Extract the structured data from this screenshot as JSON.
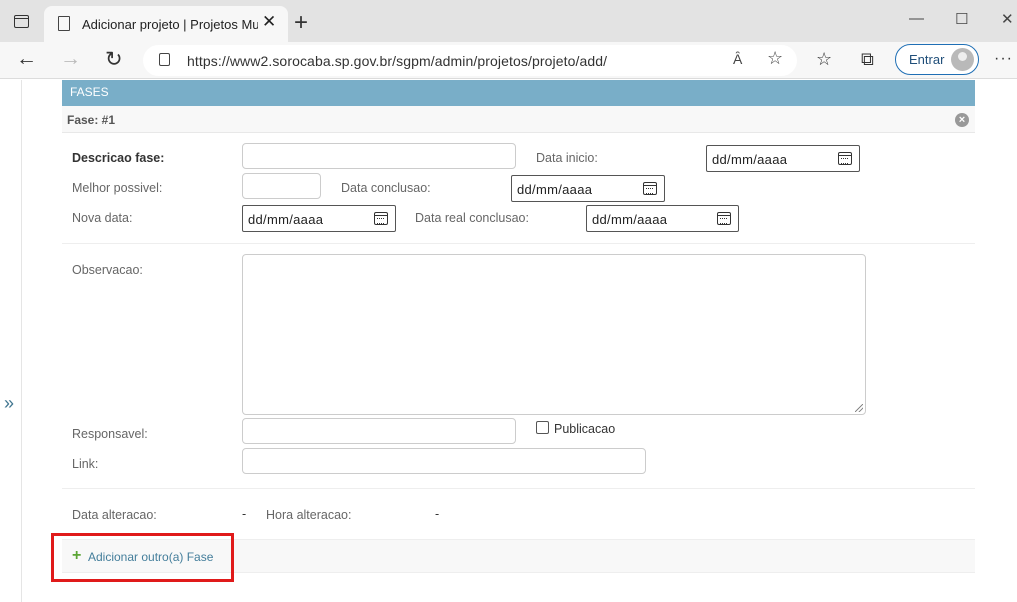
{
  "browser": {
    "tab_title": "Adicionar projeto | Projetos Mun",
    "tab_close": "✕",
    "new_tab": "+",
    "url": "https://www2.sorocaba.sp.gov.br/sgpm/admin/projetos/projeto/add/",
    "read_aloud": "Ȃ",
    "signin_label": "Entrar",
    "window_controls": [
      "—",
      "☐",
      "✕"
    ]
  },
  "sidebar": {
    "expand_label": "»"
  },
  "inline": {
    "section_title": "FASES",
    "fase_title": "Fase: #1",
    "fields": {
      "descricao_label": "Descricao fase:",
      "data_inicio_label": "Data inicio:",
      "data_inicio_value": "dd/mm/aaaa",
      "melhor_label": "Melhor possivel:",
      "data_conclusao_label": "Data conclusao:",
      "data_conclusao_value": "dd/mm/aaaa",
      "nova_data_label": "Nova data:",
      "nova_data_value": "dd/mm/aaaa",
      "data_real_label": "Data real conclusao:",
      "data_real_value": "dd/mm/aaaa",
      "observacao_label": "Observacao:",
      "responsavel_label": "Responsavel:",
      "publicacao_label": "Publicacao",
      "link_label": "Link:",
      "data_alteracao_label": "Data alteracao:",
      "data_alteracao_value": "-",
      "hora_alteracao_label": "Hora alteracao:",
      "hora_alteracao_value": "-"
    },
    "add_another": "Adicionar outro(a) Fase"
  },
  "colors": {
    "header": "#79aec8",
    "highlight": "#e01a1a",
    "link": "#447e9b",
    "add_icon": "#5ba534"
  }
}
